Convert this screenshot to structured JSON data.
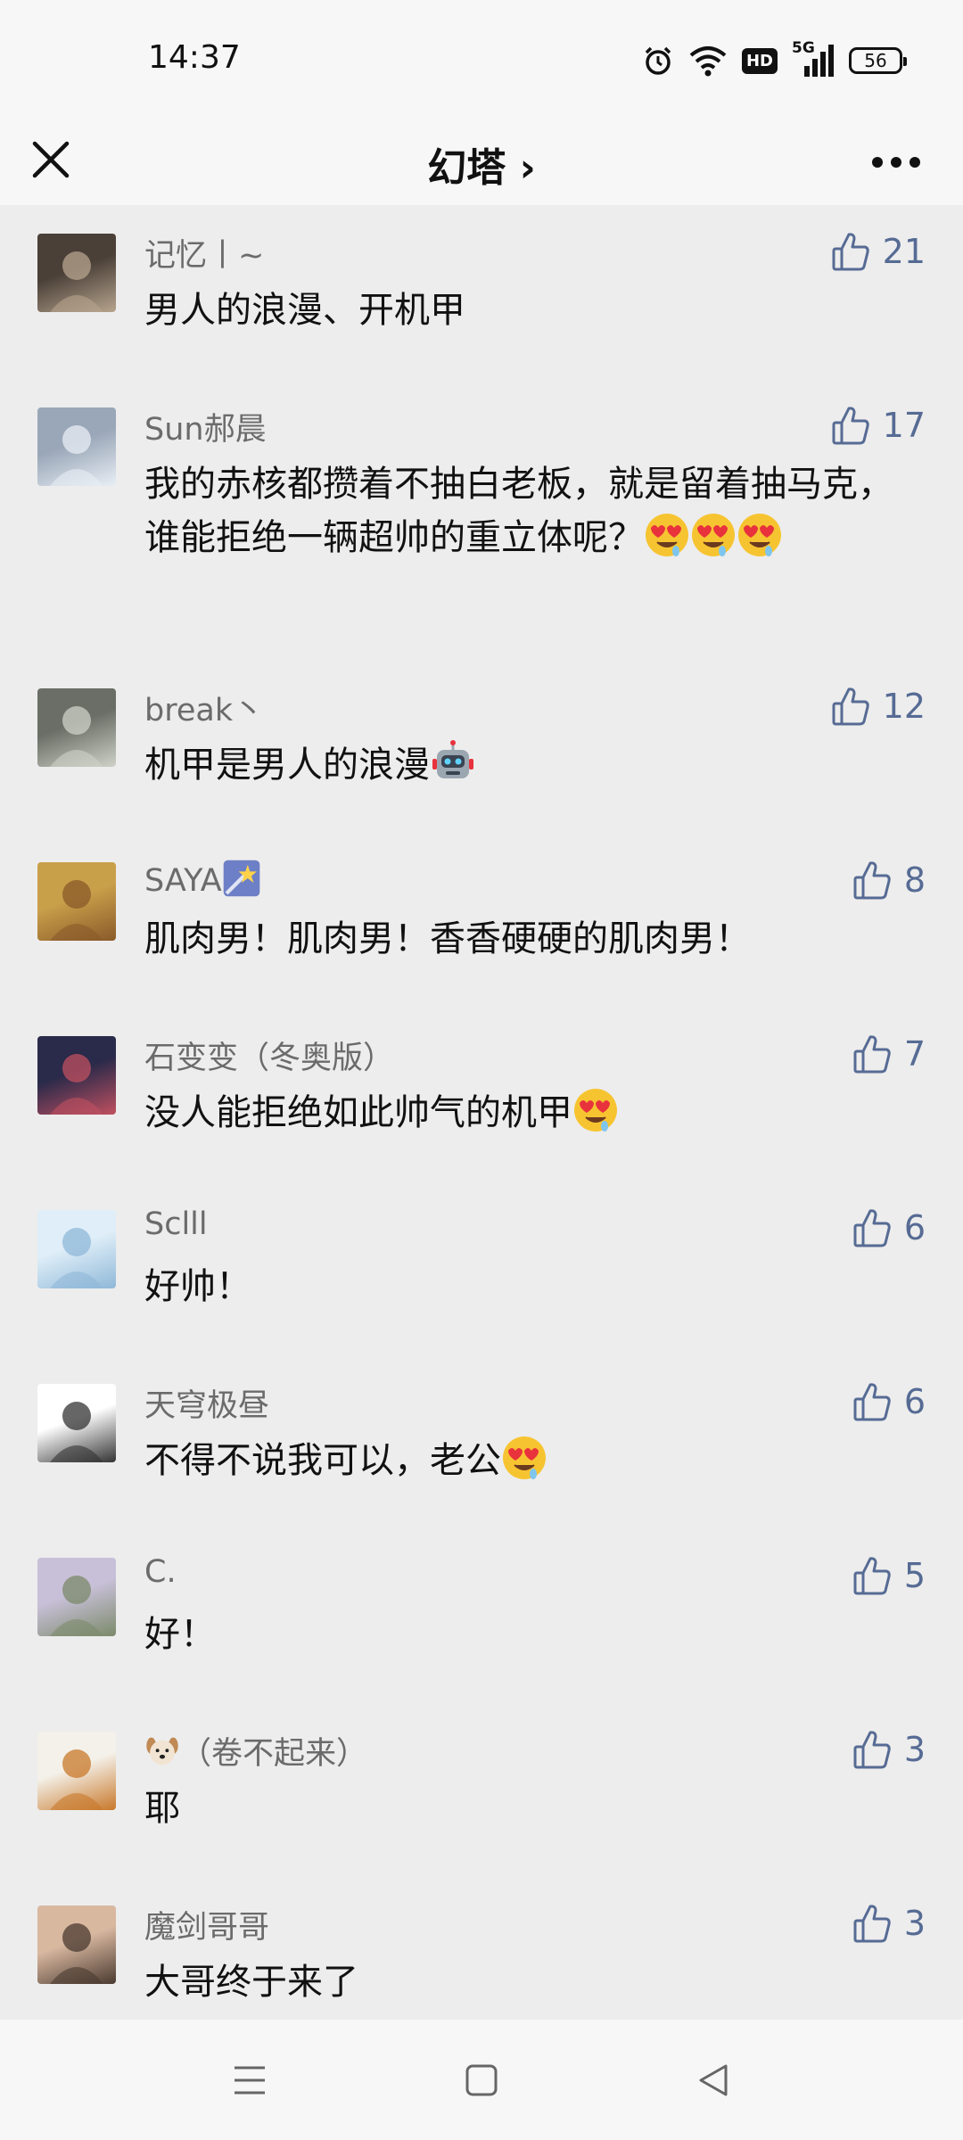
{
  "status_bar": {
    "time": "14:37",
    "network": "5G",
    "hd_label": "HD",
    "battery": "56",
    "icons": [
      "alarm-icon",
      "wifi-icon",
      "hd-icon",
      "signal-icon",
      "battery-icon"
    ]
  },
  "header": {
    "title": "幻塔 ›",
    "close_icon": "close-icon",
    "more_icon": "more-icon"
  },
  "comments": [
    {
      "name": "记忆丨~",
      "text": "男人的浪漫、开机甲",
      "likes": "21"
    },
    {
      "name": "Sun郝晨",
      "text": "我的赤核都攒着不抽白老板，就是留着抽马克，谁能拒绝一辆超帅的重立体呢？",
      "likes": "17",
      "emoji": "heart-eyes-drool x3"
    },
    {
      "name": "break丶",
      "text": "机甲是男人的浪漫",
      "likes": "12",
      "emoji": "robot"
    },
    {
      "name": "SAYA",
      "text": "肌肉男！肌肉男！香香硬硬的肌肉男！",
      "likes": "8",
      "name_emoji": "shooting-star"
    },
    {
      "name": "石变变（冬奥版）",
      "text": "没人能拒绝如此帅气的机甲",
      "likes": "7",
      "emoji": "heart-eyes-drool"
    },
    {
      "name": "Sclll",
      "text": "好帅！",
      "likes": "6"
    },
    {
      "name": "天穹极昼",
      "text": "不得不说我可以，老公",
      "likes": "6",
      "emoji": "heart-eyes-drool"
    },
    {
      "name": "C.",
      "text": "好！",
      "likes": "5"
    },
    {
      "name": "（卷不起来）",
      "text": "耶",
      "likes": "3",
      "name_emoji": "dog"
    },
    {
      "name": "魔剑哥哥",
      "text": "大哥终于来了",
      "likes": "3"
    }
  ],
  "colors": {
    "background": "#ededed",
    "bar_background": "#f7f7f7",
    "like_color": "#566b94",
    "name_color": "#6b6b6b"
  },
  "nav_bar": {
    "icons": [
      "menu-icon",
      "home-icon",
      "back-icon"
    ]
  }
}
